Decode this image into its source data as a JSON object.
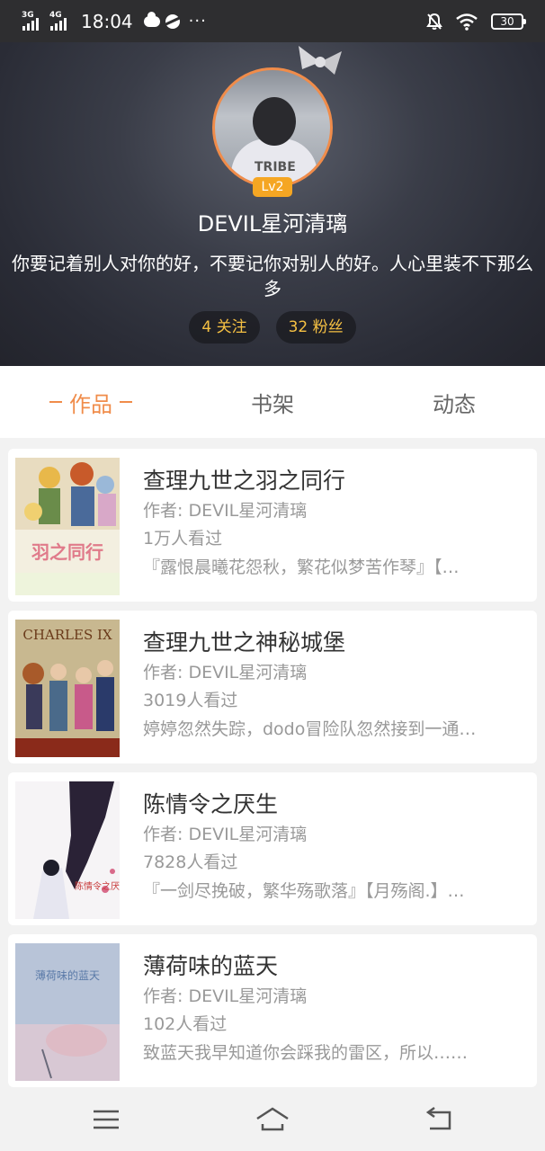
{
  "status_bar": {
    "network1": "3G",
    "network2": "4G",
    "time": "18:04",
    "more": "···",
    "battery": "30",
    "icons": [
      "weather-cloud-icon",
      "planet-icon",
      "mute-bell-icon",
      "wifi-icon",
      "battery-icon"
    ]
  },
  "profile": {
    "level": "Lv2",
    "username": "DEVIL星河清璃",
    "bio": "你要记着别人对你的好，不要记你对别人的好。人心里装不下那么多",
    "following": "4 关注",
    "followers": "32 粉丝",
    "avatar_shirt_text": "TRIBE"
  },
  "tabs": [
    {
      "label": "作品",
      "active": true
    },
    {
      "label": "书架",
      "active": false
    },
    {
      "label": "动态",
      "active": false
    }
  ],
  "works": [
    {
      "title": "查理九世之羽之同行",
      "author": "作者: DEVIL星河清璃",
      "views": "1万人看过",
      "desc": "『露恨晨曦花怨秋，繁花似梦苦作琴』【…",
      "cover_text": "羽之同行"
    },
    {
      "title": "查理九世之神秘城堡",
      "author": "作者: DEVIL星河清璃",
      "views": "3019人看过",
      "desc": "婷婷忽然失踪，dodo冒险队忽然接到一通…",
      "cover_text": "CHARLES IX"
    },
    {
      "title": "陈情令之厌生",
      "author": "作者: DEVIL星河清璃",
      "views": "7828人看过",
      "desc": "『一剑尽挽破，繁华殇歌落』【月殇阁.】…",
      "cover_text": "陈情令之厌生"
    },
    {
      "title": "薄荷味的蓝天",
      "author": "作者: DEVIL星河清璃",
      "views": "102人看过",
      "desc": "致蓝天我早知道你会踩我的雷区，所以……",
      "cover_text": "薄荷味的蓝天"
    }
  ],
  "colors": {
    "accent": "#f08c4a",
    "badge": "#f5a623",
    "stat_text": "#f5c043"
  }
}
